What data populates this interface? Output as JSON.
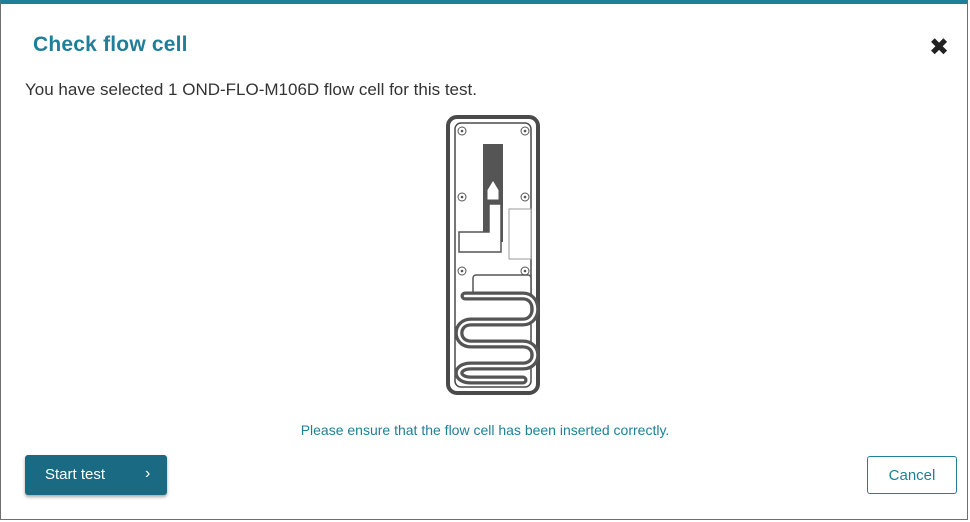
{
  "dialog": {
    "title": "Check flow cell",
    "close_glyph": "✖",
    "message": "You have selected 1 OND-FLO-M106D flow cell for this test.",
    "hint": "Please ensure that the flow cell has been inserted correctly."
  },
  "buttons": {
    "start_label": "Start test",
    "start_chevron": "›",
    "cancel_label": "Cancel"
  },
  "icons": {
    "close": "close-icon",
    "start_chevron": "chevron-right-icon",
    "flow_cell": "flow-cell-illustration"
  },
  "colors": {
    "accent": "#1f7f98",
    "primary_button": "#196a82",
    "text": "#333333"
  }
}
